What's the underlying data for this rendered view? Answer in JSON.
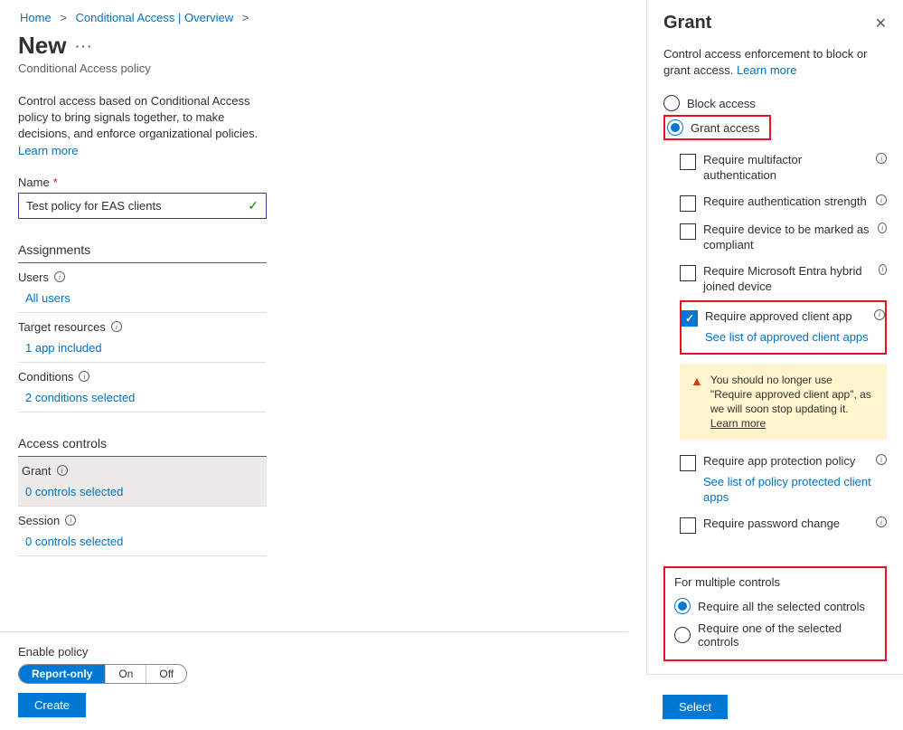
{
  "breadcrumb": {
    "home": "Home",
    "ca": "Conditional Access | Overview"
  },
  "page": {
    "title": "New",
    "subtitle": "Conditional Access policy"
  },
  "intro": {
    "text": "Control access based on Conditional Access policy to bring signals together, to make decisions, and enforce organizational policies.",
    "learn_more": "Learn more"
  },
  "name": {
    "label": "Name",
    "value": "Test policy for EAS clients"
  },
  "assignments": {
    "header": "Assignments",
    "users": {
      "label": "Users",
      "value": "All users"
    },
    "target": {
      "label": "Target resources",
      "value": "1 app included"
    },
    "conditions": {
      "label": "Conditions",
      "value": "2 conditions selected"
    }
  },
  "access_controls": {
    "header": "Access controls",
    "grant": {
      "label": "Grant",
      "value": "0 controls selected"
    },
    "session": {
      "label": "Session",
      "value": "0 controls selected"
    }
  },
  "enable": {
    "label": "Enable policy",
    "options": [
      "Report-only",
      "On",
      "Off"
    ]
  },
  "buttons": {
    "create": "Create",
    "select": "Select"
  },
  "grant_panel": {
    "title": "Grant",
    "intro": "Control access enforcement to block or grant access.",
    "learn_more": "Learn more",
    "block": "Block access",
    "grant": "Grant access",
    "controls": {
      "mfa": "Require multifactor authentication",
      "auth_strength": "Require authentication strength",
      "compliant": "Require device to be marked as compliant",
      "hybrid": "Require Microsoft Entra hybrid joined device",
      "approved_app": "Require approved client app",
      "approved_link": "See list of approved client apps",
      "protection": "Require app protection policy",
      "protection_link": "See list of policy protected client apps",
      "password": "Require password change"
    },
    "warning": {
      "text": "You should no longer use \"Require approved client app\", as we will soon stop updating it.",
      "learn_more": "Learn more"
    },
    "multiple": {
      "title": "For multiple controls",
      "all": "Require all the selected controls",
      "one": "Require one of the selected controls"
    }
  }
}
